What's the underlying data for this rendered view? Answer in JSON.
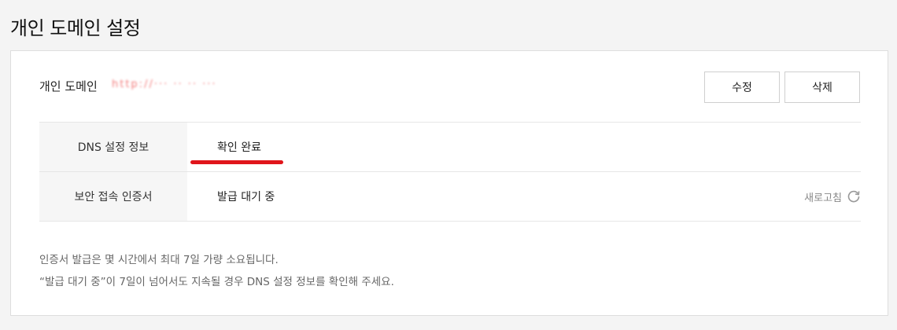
{
  "page": {
    "title": "개인 도메인 설정"
  },
  "domain": {
    "label": "개인 도메인",
    "value": "http://··· ·· ·· ···"
  },
  "buttons": {
    "edit": "수정",
    "delete": "삭제"
  },
  "table": {
    "dns": {
      "label": "DNS 설정 정보",
      "value": "확인 완료"
    },
    "ssl": {
      "label": "보안 접속 인증서",
      "value": "발급 대기 중",
      "refresh": "새로고침"
    }
  },
  "notes": [
    "인증서 발급은 몇 시간에서 최대 7일 가량 소요됩니다.",
    "“발급 대기 중”이 7일이 넘어서도 지속될 경우 DNS 설정 정보를 확인해 주세요."
  ],
  "colors": {
    "highlight_underline": "#e0151b",
    "domain_redacted": "#f05a5a"
  },
  "icons": {
    "refresh": "refresh-icon"
  }
}
